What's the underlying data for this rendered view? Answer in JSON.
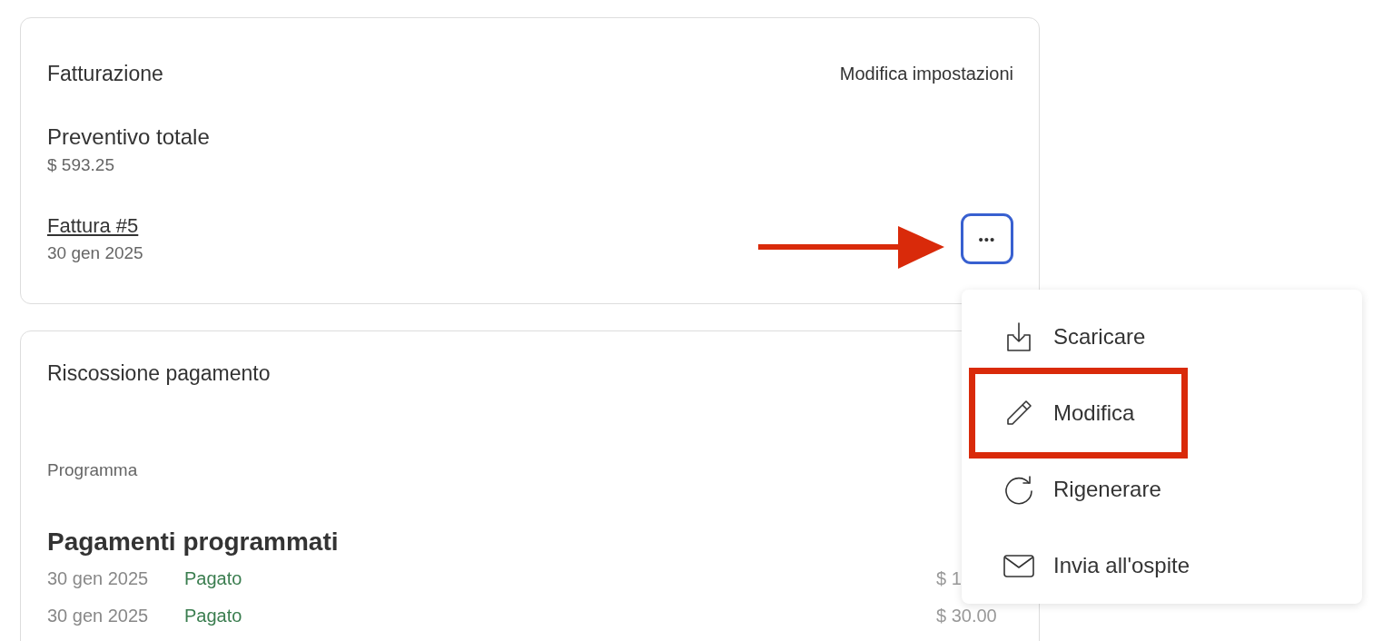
{
  "billing": {
    "title": "Fatturazione",
    "settings_link": "Modifica impostazioni",
    "estimate_label": "Preventivo totale",
    "estimate_value": "$ 593.25",
    "invoice_link": "Fattura #5",
    "invoice_date": "30 gen 2025",
    "more_button": "•••",
    "more_focused": true
  },
  "collection": {
    "title": "Riscossione pagamento",
    "schedule_label": "Programma",
    "heading": "Pagamenti programmati",
    "payments": [
      {
        "date": "30 gen 2025",
        "status": "Pagato",
        "amount": "$ 1"
      },
      {
        "date": "30 gen 2025",
        "status": "Pagato",
        "amount": "$ 30.00"
      }
    ]
  },
  "menu": {
    "items": [
      {
        "kind": "download",
        "label": "Scaricare",
        "highlighted": false
      },
      {
        "kind": "edit",
        "label": "Modifica",
        "highlighted": true
      },
      {
        "kind": "refresh",
        "label": "Rigenerare",
        "highlighted": false
      },
      {
        "kind": "mail",
        "label": "Invia all'ospite",
        "highlighted": false
      }
    ]
  }
}
